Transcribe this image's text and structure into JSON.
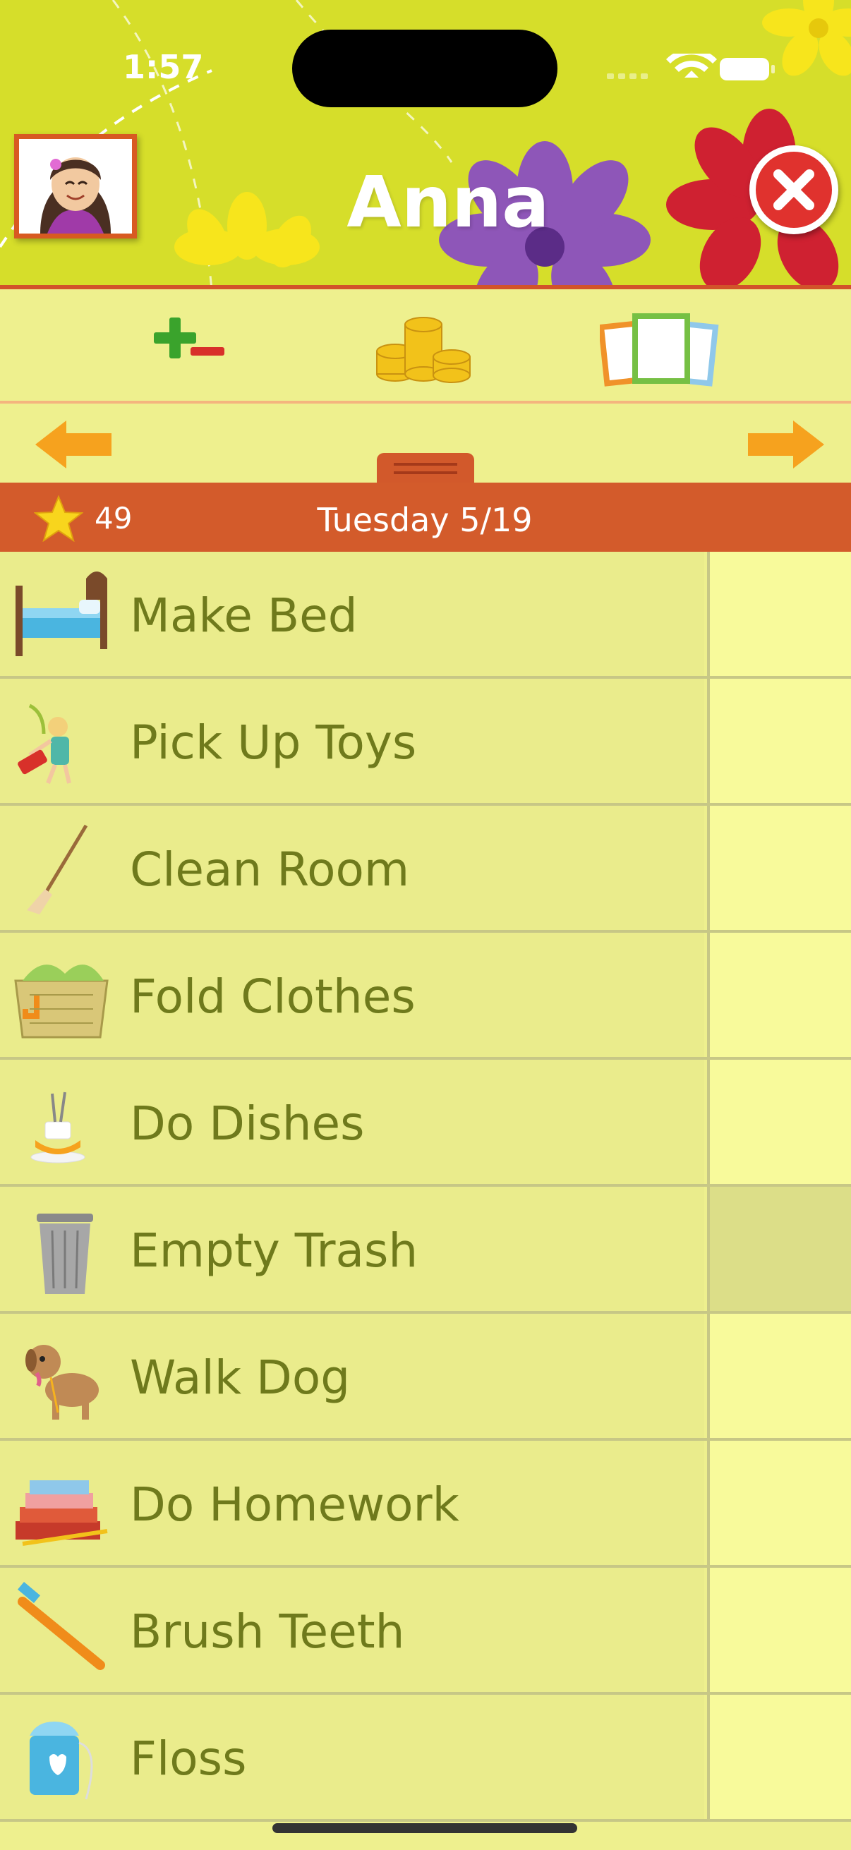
{
  "status_bar": {
    "time": "1:57"
  },
  "header": {
    "child_name": "Anna",
    "avatar_icon": "girl-portrait-icon",
    "close_icon": "close-icon"
  },
  "toolbar": {
    "items": [
      {
        "name": "add-subtract-points-icon"
      },
      {
        "name": "coins-rewards-icon"
      },
      {
        "name": "cards-icon"
      }
    ]
  },
  "date_bar": {
    "stars": "49",
    "date": "Tuesday 5/19"
  },
  "chores": [
    {
      "label": "Make Bed",
      "icon": "bed-icon",
      "checked_cell_dim": false
    },
    {
      "label": "Pick Up Toys",
      "icon": "toys-icon",
      "checked_cell_dim": false
    },
    {
      "label": "Clean Room",
      "icon": "broom-icon",
      "checked_cell_dim": false
    },
    {
      "label": "Fold Clothes",
      "icon": "laundry-basket-icon",
      "checked_cell_dim": false
    },
    {
      "label": "Do Dishes",
      "icon": "dishes-icon",
      "checked_cell_dim": false
    },
    {
      "label": "Empty Trash",
      "icon": "trash-can-icon",
      "checked_cell_dim": true
    },
    {
      "label": "Walk Dog",
      "icon": "dog-icon",
      "checked_cell_dim": false
    },
    {
      "label": "Do Homework",
      "icon": "books-icon",
      "checked_cell_dim": false
    },
    {
      "label": "Brush Teeth",
      "icon": "toothbrush-icon",
      "checked_cell_dim": false
    },
    {
      "label": "Floss",
      "icon": "floss-icon",
      "checked_cell_dim": false
    }
  ],
  "colors": {
    "header_bg": "#d6de2a",
    "accent_orange": "#d35b2b",
    "row_bg": "#eaec8c",
    "cell_bg": "#f8fa9b",
    "text_olive": "#6f7a1c"
  }
}
